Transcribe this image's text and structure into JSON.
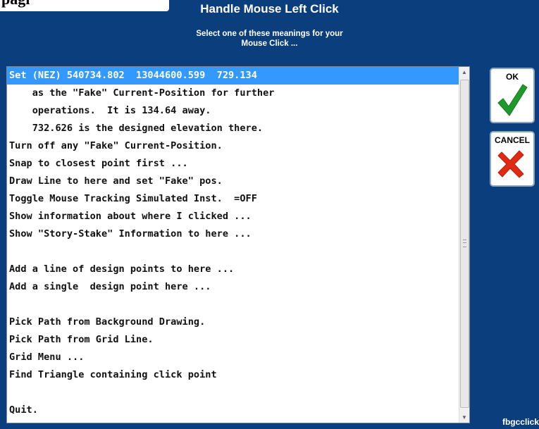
{
  "header": {
    "title_fragment": "pagi",
    "title": "Handle Mouse Left Click",
    "subtitle": "Select one of these meanings for your\nMouse Click ..."
  },
  "options": [
    {
      "label": "Set (NEZ) 540734.802  13044600.599  729.134",
      "selected": true
    },
    {
      "label": "    as the \"Fake\" Current-Position for further"
    },
    {
      "label": "    operations.  It is 134.64 away."
    },
    {
      "label": "    732.626 is the designed elevation there."
    },
    {
      "label": "Turn off any \"Fake\" Current-Position."
    },
    {
      "label": "Snap to closest point first ..."
    },
    {
      "label": "Draw Line to here and set \"Fake\" pos."
    },
    {
      "label": "Toggle Mouse Tracking Simulated Inst.  =OFF"
    },
    {
      "label": "Show information about where I clicked ..."
    },
    {
      "label": "Show \"Story-Stake\" Information to here ..."
    },
    {
      "label": ""
    },
    {
      "label": "Add a line of design points to here ..."
    },
    {
      "label": "Add a single  design point here ..."
    },
    {
      "label": ""
    },
    {
      "label": "Pick Path from Background Drawing."
    },
    {
      "label": "Pick Path from Grid Line."
    },
    {
      "label": "Grid Menu ..."
    },
    {
      "label": "Find Triangle containing click point"
    },
    {
      "label": ""
    },
    {
      "label": "Quit."
    }
  ],
  "buttons": {
    "ok_label": "OK",
    "cancel_label": "CANCEL",
    "ok_icon": "green-checkmark-icon",
    "cancel_icon": "red-x-icon"
  },
  "footer": {
    "text": "fbgcclick"
  },
  "colors": {
    "background": "#0a3e7c",
    "selection": "#3399ff",
    "check_green": "#1f9a2a",
    "cancel_red": "#e02a12"
  }
}
